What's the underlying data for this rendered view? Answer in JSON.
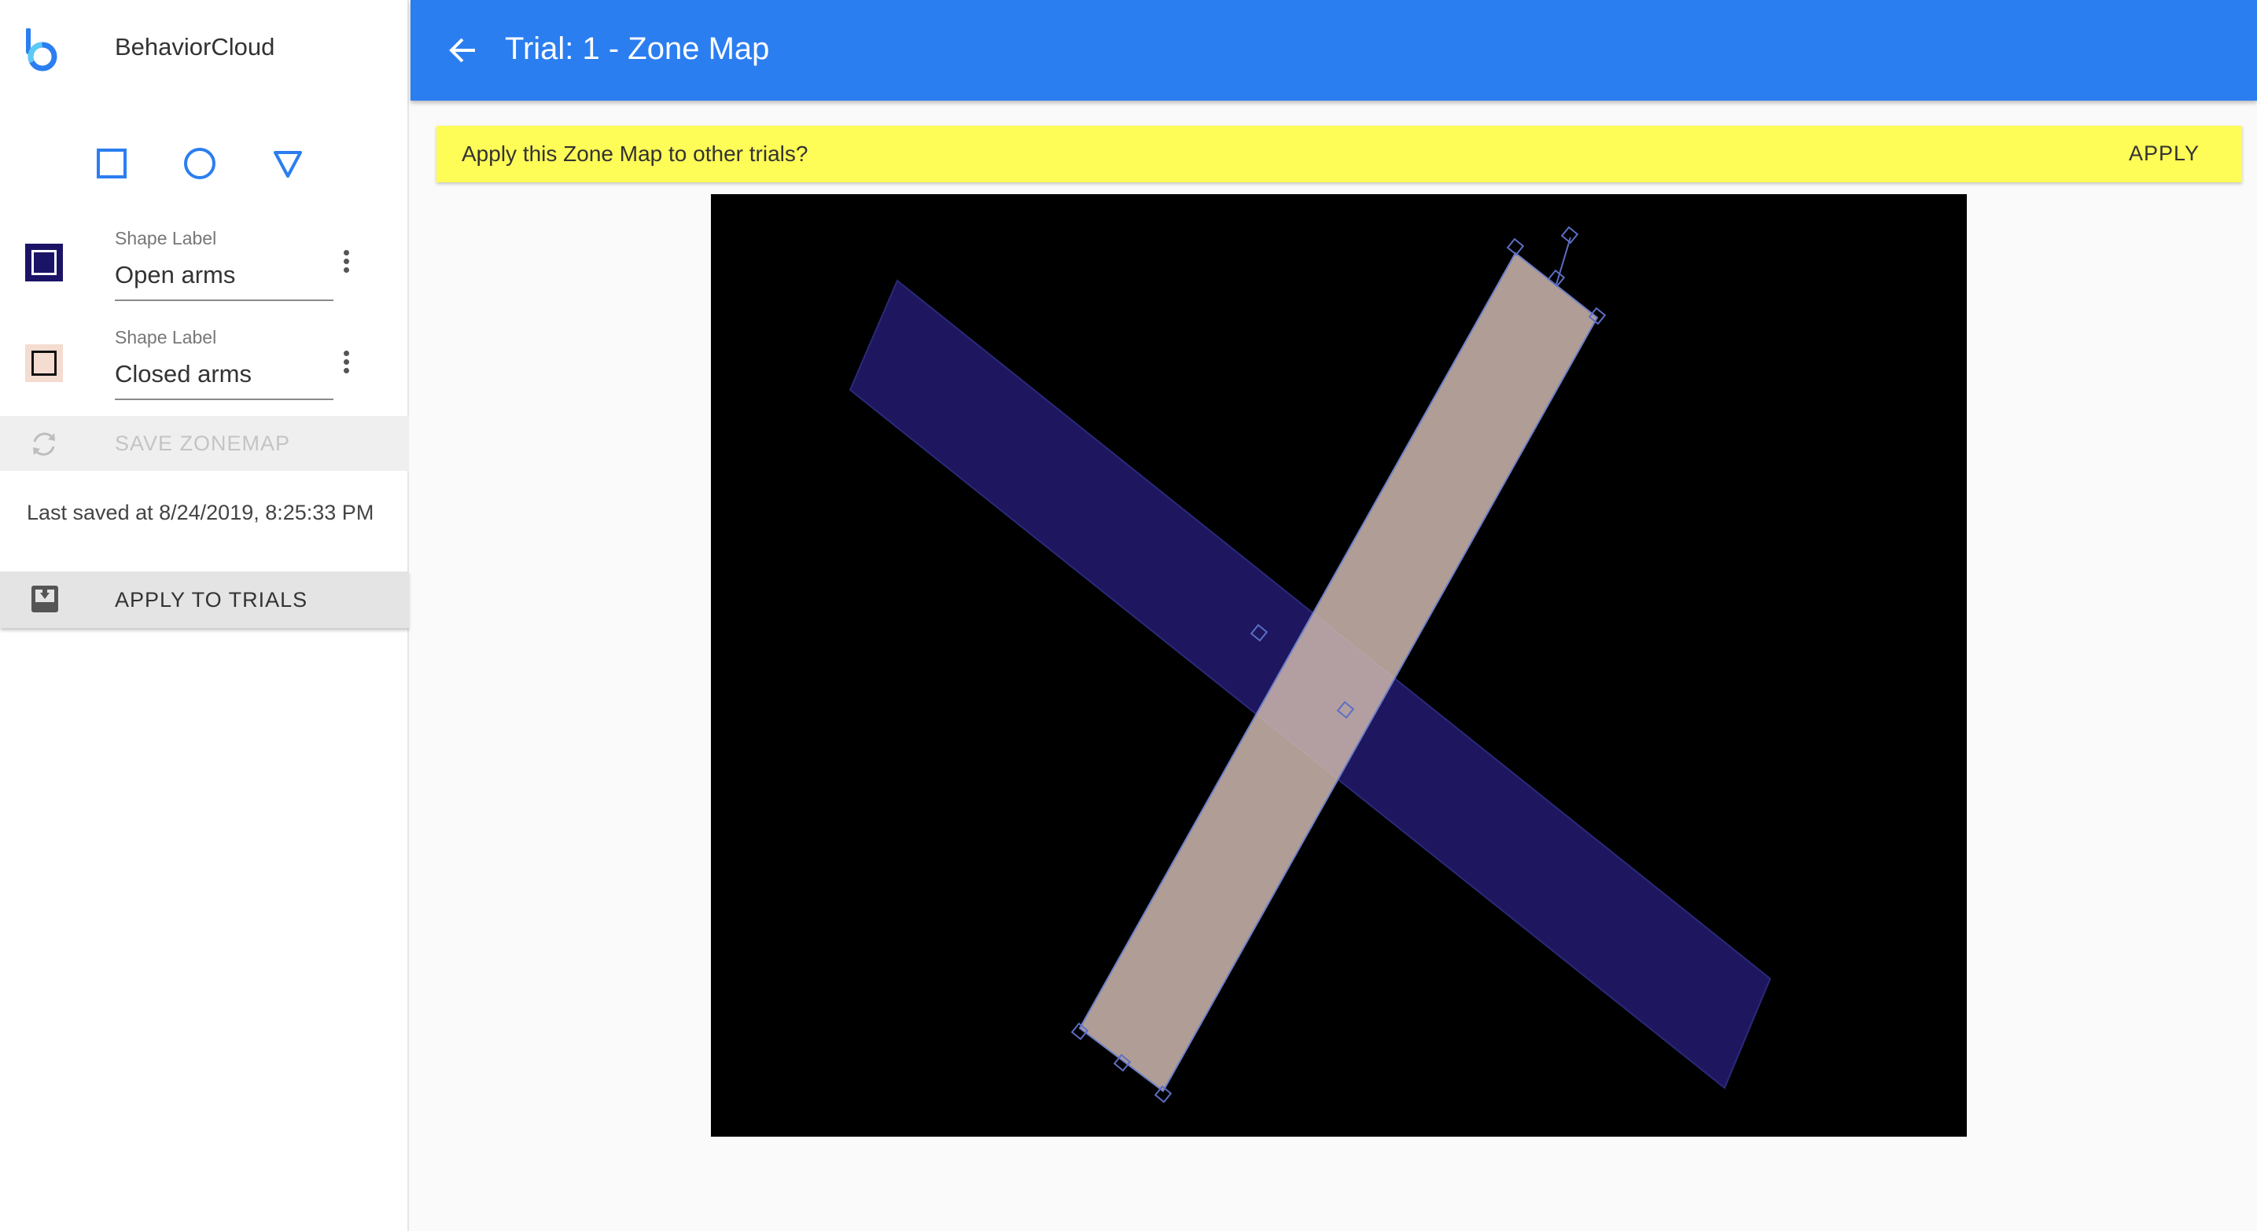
{
  "app": {
    "name": "BehaviorCloud"
  },
  "header": {
    "title": "Trial: 1 - Zone Map",
    "back_icon": "arrow-left-icon"
  },
  "toolbar": {
    "tools": [
      {
        "name": "rectangle-tool",
        "icon": "square-icon"
      },
      {
        "name": "circle-tool",
        "icon": "circle-icon"
      },
      {
        "name": "triangle-tool",
        "icon": "triangle-icon"
      }
    ]
  },
  "shapes": [
    {
      "field_label": "Shape Label",
      "value": "Open arms",
      "color": "#1b1466"
    },
    {
      "field_label": "Shape Label",
      "value": "Closed arms",
      "color": "#f2d8cc"
    }
  ],
  "save": {
    "label": "SAVE ZONEMAP",
    "disabled": true
  },
  "last_saved": "Last saved at 8/24/2019, 8:25:33 PM",
  "apply_trials": {
    "label": "APPLY TO TRIALS"
  },
  "banner": {
    "text": "Apply this Zone Map to other trials?",
    "button": "APPLY"
  },
  "colors": {
    "accent": "#2b7ef0",
    "banner": "#fefc56",
    "open_arms_fill": "#1e165e",
    "closed_arms_fill": "#c8b3ab",
    "canvas_bg": "#000000"
  }
}
